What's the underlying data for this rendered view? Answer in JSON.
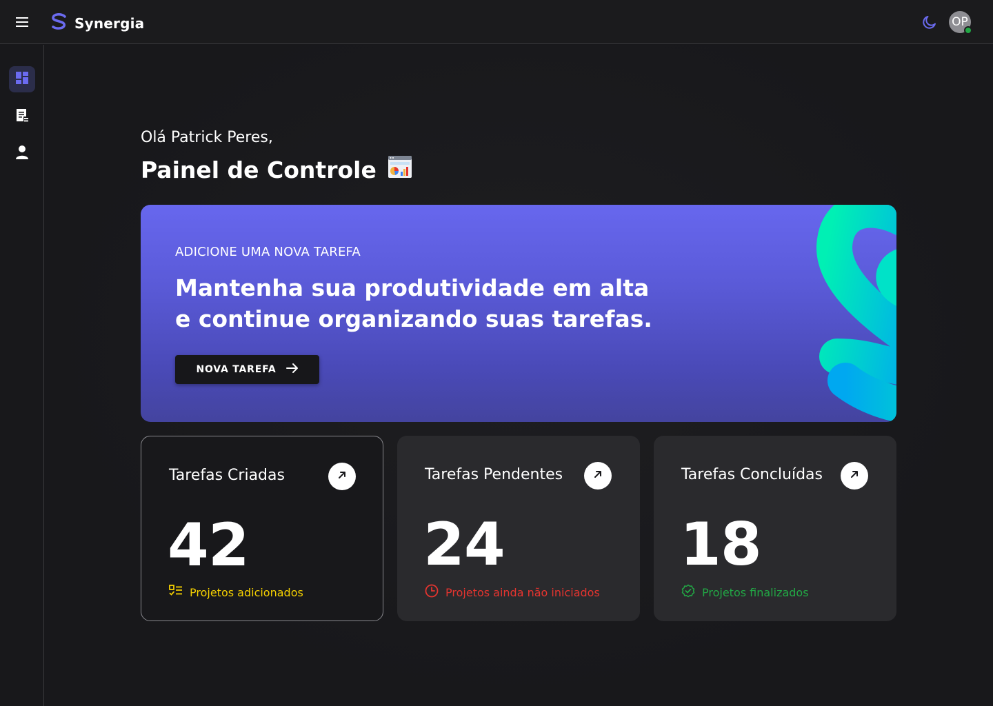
{
  "app": {
    "name": "Synergia"
  },
  "header": {
    "menu_icon": "hamburger-menu-icon",
    "theme_icon": "moon-icon",
    "avatar_initials": "OP",
    "avatar_status_color": "#22a845"
  },
  "sidebar": {
    "items": [
      {
        "id": "dashboard",
        "icon": "dashboard-icon",
        "active": true
      },
      {
        "id": "tasks",
        "icon": "document-list-icon",
        "active": false
      },
      {
        "id": "profile",
        "icon": "user-icon",
        "active": false
      }
    ]
  },
  "main": {
    "greeting": "Olá Patrick Peres,",
    "title": "Painel de Controle",
    "title_icon": "dashboard-chart-icon"
  },
  "banner": {
    "kicker": "ADICIONE UMA NOVA TAREFA",
    "headline": "Mantenha sua produtividade em alta e continue organizando suas tarefas.",
    "button_label": "NOVA TAREFA",
    "button_icon": "arrow-right-icon"
  },
  "cards": [
    {
      "title": "Tarefas Criadas",
      "value": "42",
      "footer": "Projetos adicionados",
      "footer_icon": "checklist-icon",
      "footer_color": "#f5d000"
    },
    {
      "title": "Tarefas Pendentes",
      "value": "24",
      "footer": "Projetos ainda não iniciados",
      "footer_icon": "clock-icon",
      "footer_color": "#e5342f"
    },
    {
      "title": "Tarefas Concluídas",
      "value": "18",
      "footer": "Projetos finalizados",
      "footer_icon": "verified-check-icon",
      "footer_color": "#22a845"
    }
  ],
  "colors": {
    "accent": "#6767ee",
    "logo": "#6b6bf0",
    "banner_shape_start": "#00f0b4",
    "banner_shape_end": "#00a8f0"
  }
}
